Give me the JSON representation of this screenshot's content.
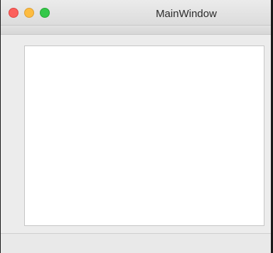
{
  "window": {
    "title": "MainWindow",
    "buttons": {
      "close_icon": "close-icon",
      "minimize_icon": "minimize-icon",
      "zoom_icon": "zoom-icon",
      "close_color": "#fc605c",
      "minimize_color": "#fdbc40",
      "zoom_color": "#34c84a"
    }
  }
}
